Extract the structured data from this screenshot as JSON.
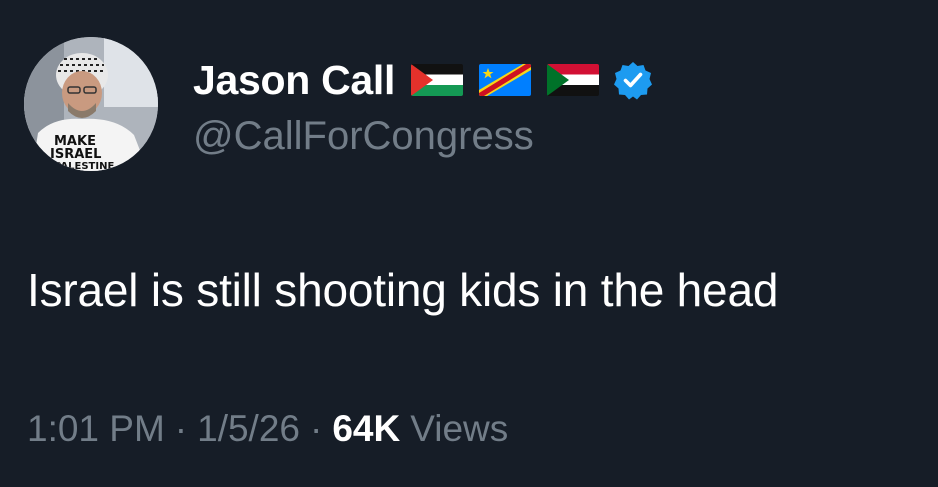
{
  "author": {
    "display_name": "Jason Call",
    "handle": "@CallForCongress",
    "verified": true,
    "verified_color": "#1d9bf0",
    "avatar_icon": "profile-photo",
    "flags": [
      "palestine-flag-icon",
      "dr-congo-flag-icon",
      "sudan-flag-icon"
    ]
  },
  "tweet": {
    "text": "Israel is still shooting kids in the head"
  },
  "meta": {
    "time": "1:01 PM",
    "separator": "·",
    "date": "1/5/26",
    "views_count": "64K",
    "views_label": "Views"
  },
  "colors": {
    "background": "#161d27",
    "primary_text": "#ffffff",
    "secondary_text": "#727d88"
  }
}
